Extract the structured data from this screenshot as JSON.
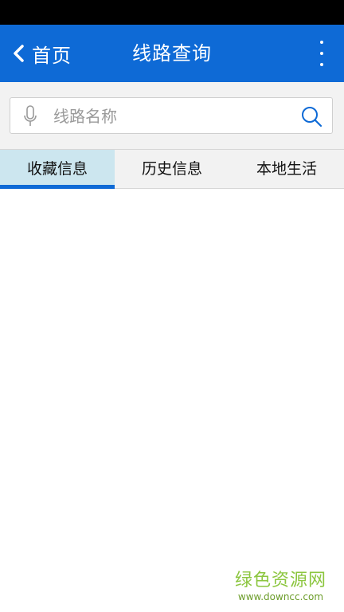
{
  "app_bar": {
    "back_label": "首页",
    "title": "线路查询"
  },
  "search": {
    "placeholder": "线路名称",
    "value": ""
  },
  "tabs": [
    {
      "label": "收藏信息",
      "active": true
    },
    {
      "label": "历史信息",
      "active": false
    },
    {
      "label": "本地生活",
      "active": false
    }
  ],
  "watermark": {
    "title": "绿色资源网",
    "url": "www.downcc.com"
  },
  "colors": {
    "primary": "#0e6ad6",
    "active_tab_bg": "#cce6ef",
    "watermark": "#8cc63f"
  }
}
